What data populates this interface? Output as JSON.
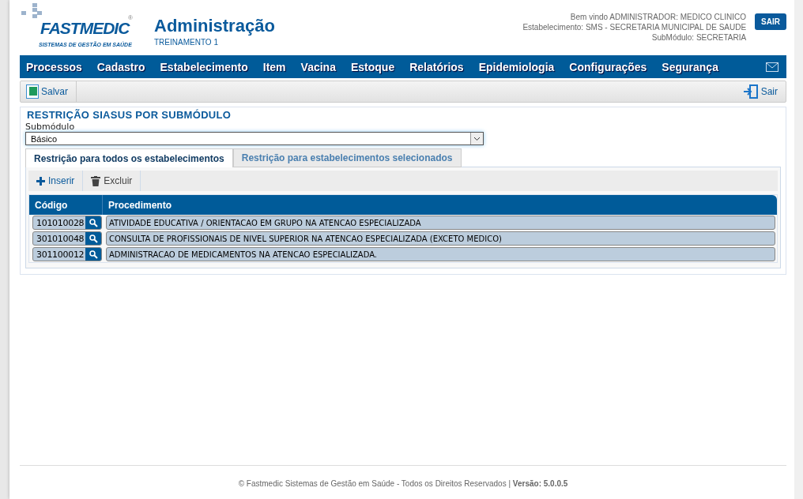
{
  "logo": {
    "name": "FASTMEDIC",
    "mark": "®",
    "tagline": "SISTEMAS DE GESTÃO EM SAÚDE"
  },
  "header": {
    "title": "Administração",
    "subtitle": "TREINAMENTO 1",
    "user_lines": [
      "Bem vindo ADMINISTRADOR: MEDICO CLINICO",
      "Estabelecimento: SMS - SECRETARIA MUNICIPAL DE SAUDE",
      "SubMódulo: SECRETARIA"
    ],
    "logout": "SAIR"
  },
  "menu": [
    "Processos",
    "Cadastro",
    "Estabelecimento",
    "Item",
    "Vacina",
    "Estoque",
    "Relatórios",
    "Epidemiologia",
    "Configurações",
    "Segurança"
  ],
  "toolbar": {
    "save": "Salvar",
    "exit": "Sair"
  },
  "section": {
    "title": "RESTRIÇÃO SIASUS POR SUBMÓDULO",
    "field_label": "Submódulo",
    "field_value": "Básico"
  },
  "tabs": [
    {
      "label": "Restrição para todos os estabelecimentos",
      "selected": true
    },
    {
      "label": "Restrição para estabelecimentos selecionados",
      "selected": false
    }
  ],
  "actions": [
    "Inserir",
    "Excluir"
  ],
  "table": {
    "columns": [
      "Código",
      "Procedimento"
    ],
    "rows": [
      {
        "code": "101010028",
        "procedure": "ATIVIDADE EDUCATIVA / ORIENTACAO EM GRUPO NA ATENCAO ESPECIALIZADA"
      },
      {
        "code": "301010048",
        "procedure": "CONSULTA DE PROFISSIONAIS DE NIVEL SUPERIOR NA ATENCAO ESPECIALIZADA (EXCETO MEDICO)"
      },
      {
        "code": "301100012",
        "procedure": "ADMINISTRACAO DE MEDICAMENTOS NA ATENCAO ESPECIALIZADA."
      }
    ]
  },
  "footer": "© Fastmedic Sistemas de Gestão em Saúde - Todos os Direitos Reservados | **Versão: 5.0.0.5**"
}
